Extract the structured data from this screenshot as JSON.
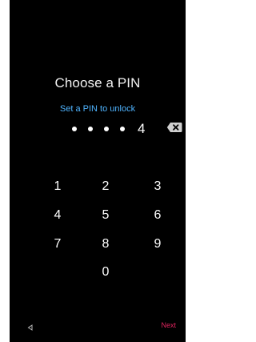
{
  "screen": {
    "title": "Choose a PIN",
    "subtitle": "Set a PIN to unlock",
    "pin_masked_count": 4,
    "pin_last_digit": "4"
  },
  "keypad": {
    "keys": [
      "1",
      "2",
      "3",
      "4",
      "5",
      "6",
      "7",
      "8",
      "9",
      "0"
    ]
  },
  "footer": {
    "next_label": "Next"
  },
  "colors": {
    "background": "#000000",
    "accent_blue": "#4fb4ff",
    "accent_pink": "#e0245e"
  },
  "icons": {
    "backspace": "backspace-icon",
    "back": "back-triangle-icon"
  }
}
